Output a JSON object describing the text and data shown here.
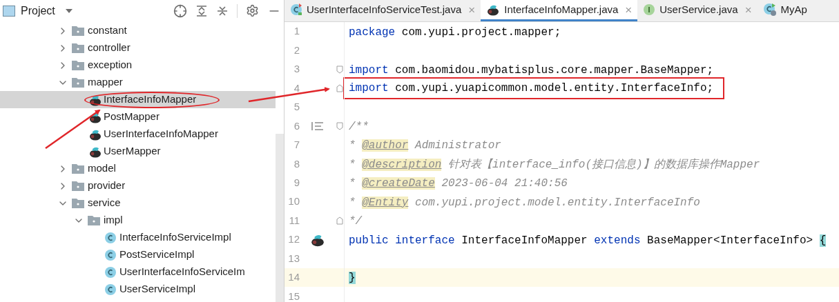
{
  "project_panel": {
    "title": "Project",
    "tree": [
      {
        "label": "constant",
        "kind": "folder",
        "expanded": false,
        "selected": false
      },
      {
        "label": "controller",
        "kind": "folder",
        "expanded": false,
        "selected": false
      },
      {
        "label": "exception",
        "kind": "folder",
        "expanded": false,
        "selected": false
      },
      {
        "label": "mapper",
        "kind": "folder",
        "expanded": true,
        "selected": false,
        "children": [
          {
            "label": "InterfaceInfoMapper",
            "kind": "mapper",
            "selected": true,
            "annotated": true
          },
          {
            "label": "PostMapper",
            "kind": "mapper",
            "selected": false,
            "annotated": false
          },
          {
            "label": "UserInterfaceInfoMapper",
            "kind": "mapper",
            "selected": false,
            "annotated": false
          },
          {
            "label": "UserMapper",
            "kind": "mapper",
            "selected": false,
            "annotated": false
          }
        ]
      },
      {
        "label": "model",
        "kind": "folder",
        "expanded": false,
        "selected": false
      },
      {
        "label": "provider",
        "kind": "folder",
        "expanded": false,
        "selected": false
      },
      {
        "label": "service",
        "kind": "folder",
        "expanded": true,
        "selected": false,
        "children": [
          {
            "label": "impl",
            "kind": "folder",
            "expanded": true,
            "selected": false,
            "children": [
              {
                "label": "InterfaceInfoServiceImpl",
                "kind": "class",
                "selected": false,
                "annotated": false
              },
              {
                "label": "PostServiceImpl",
                "kind": "class",
                "selected": false,
                "annotated": false
              },
              {
                "label": "UserInterfaceInfoServiceIm",
                "kind": "class",
                "selected": false,
                "annotated": false
              },
              {
                "label": "UserServiceImpl",
                "kind": "class",
                "selected": false,
                "annotated": false
              }
            ]
          }
        ]
      }
    ]
  },
  "editor": {
    "tabs": [
      {
        "label": "UserInterfaceInfoServiceTest.java",
        "kind": "test",
        "selected": false,
        "close": "×"
      },
      {
        "label": "InterfaceInfoMapper.java",
        "kind": "mapper",
        "selected": true,
        "close": "×"
      },
      {
        "label": "UserService.java",
        "kind": "interface",
        "selected": false,
        "close": "×"
      },
      {
        "label": "MyAp",
        "kind": "run",
        "selected": false
      }
    ],
    "lines": [
      {
        "number": "1",
        "tokens": [
          {
            "kind": "keyword",
            "text": "package"
          },
          {
            "kind": "plain",
            "text": " com.yupi.project.mapper;"
          }
        ]
      },
      {
        "number": "2"
      },
      {
        "number": "3",
        "fold_open": true,
        "tokens": [
          {
            "kind": "keyword",
            "text": "import"
          },
          {
            "kind": "plain",
            "text": " com.baomidou.mybatisplus.core.mapper.BaseMapper;"
          }
        ]
      },
      {
        "number": "4",
        "fold_close": true,
        "annotated": true,
        "tokens": [
          {
            "kind": "keyword",
            "text": "import"
          },
          {
            "kind": "plain",
            "text": " com.yupi.yuapicommon.model.entity.InterfaceInfo;"
          }
        ]
      },
      {
        "number": "5"
      },
      {
        "number": "6",
        "fold_open": true,
        "doc_icon": true,
        "tokens": [
          {
            "kind": "comment",
            "text": "/**"
          }
        ]
      },
      {
        "number": "7",
        "tokens": [
          {
            "kind": "comment",
            "text": "* "
          },
          {
            "kind": "tag",
            "text": "@author"
          },
          {
            "kind": "comment",
            "text": " Administrator"
          }
        ]
      },
      {
        "number": "8",
        "tokens": [
          {
            "kind": "comment",
            "text": "* "
          },
          {
            "kind": "tag",
            "text": "@description"
          },
          {
            "kind": "comment",
            "text": " 针对表【interface_info(接口信息)】的数据库操作Mapper"
          }
        ]
      },
      {
        "number": "9",
        "tokens": [
          {
            "kind": "comment",
            "text": "* "
          },
          {
            "kind": "tag",
            "text": "@createDate"
          },
          {
            "kind": "comment",
            "text": " 2023-06-04 21:40:56"
          }
        ]
      },
      {
        "number": "10",
        "tokens": [
          {
            "kind": "comment",
            "text": "* "
          },
          {
            "kind": "tag",
            "text": "@Entity"
          },
          {
            "kind": "comment",
            "text": " com.yupi.project.model.entity.InterfaceInfo"
          }
        ]
      },
      {
        "number": "11",
        "fold_close": true,
        "tokens": [
          {
            "kind": "comment",
            "text": "*/"
          }
        ]
      },
      {
        "number": "12",
        "mapper_icon": true,
        "tokens": [
          {
            "kind": "keyword",
            "text": "public"
          },
          {
            "kind": "keyword",
            "text": " interface"
          },
          {
            "kind": "plain",
            "text": " InterfaceInfoMapper "
          },
          {
            "kind": "keyword",
            "text": "extends"
          },
          {
            "kind": "plain",
            "text": " BaseMapper<InterfaceInfo> "
          },
          {
            "kind": "brace",
            "text": "{"
          }
        ]
      },
      {
        "number": "13"
      },
      {
        "number": "14",
        "current": true,
        "tokens": [
          {
            "kind": "brace",
            "text": "}"
          }
        ]
      },
      {
        "number": "15"
      }
    ]
  }
}
